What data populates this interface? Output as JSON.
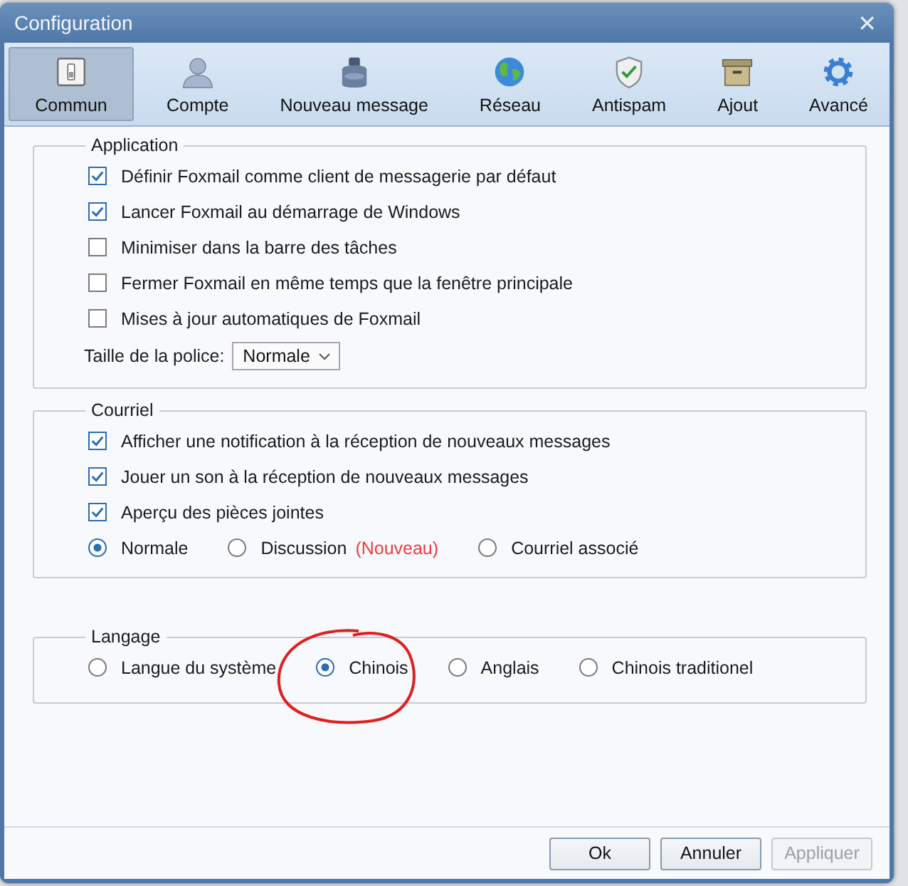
{
  "window": {
    "title": "Configuration",
    "close": "✕"
  },
  "tabs": [
    {
      "label": "Commun",
      "selected": true
    },
    {
      "label": "Compte",
      "selected": false
    },
    {
      "label": "Nouveau message",
      "selected": false
    },
    {
      "label": "Réseau",
      "selected": false
    },
    {
      "label": "Antispam",
      "selected": false
    },
    {
      "label": "Ajout",
      "selected": false
    },
    {
      "label": "Avancé",
      "selected": false
    }
  ],
  "application": {
    "title": "Application",
    "options": [
      {
        "label": "Définir Foxmail comme client de messagerie par défaut",
        "checked": true
      },
      {
        "label": "Lancer Foxmail au démarrage de Windows",
        "checked": true
      },
      {
        "label": "Minimiser dans la barre des tâches",
        "checked": false
      },
      {
        "label": "Fermer Foxmail en même temps que la fenêtre principale",
        "checked": false
      },
      {
        "label": "Mises à jour automatiques de Foxmail",
        "checked": false
      }
    ],
    "font_size": {
      "label": "Taille de la police:",
      "value": "Normale"
    }
  },
  "mail": {
    "title": "Courriel",
    "options": [
      {
        "label": "Afficher une notification à la réception de nouveaux messages",
        "checked": true
      },
      {
        "label": "Jouer un son à la réception de nouveaux messages",
        "checked": true
      },
      {
        "label": "Aperçu des pièces jointes",
        "checked": true
      }
    ],
    "modes": [
      {
        "label": "Normale",
        "selected": true
      },
      {
        "label": "Discussion",
        "badge": "(Nouveau)",
        "selected": false
      },
      {
        "label": "Courriel associé",
        "selected": false
      }
    ]
  },
  "language": {
    "title": "Langage",
    "options": [
      {
        "label": "Langue du système",
        "selected": false
      },
      {
        "label": "Chinois",
        "selected": true,
        "annotated": true
      },
      {
        "label": "Anglais",
        "selected": false
      },
      {
        "label": "Chinois traditionel",
        "selected": false
      }
    ]
  },
  "buttons": [
    {
      "label": "Ok",
      "disabled": false
    },
    {
      "label": "Annuler",
      "disabled": false
    },
    {
      "label": "Appliquer",
      "disabled": true
    }
  ]
}
